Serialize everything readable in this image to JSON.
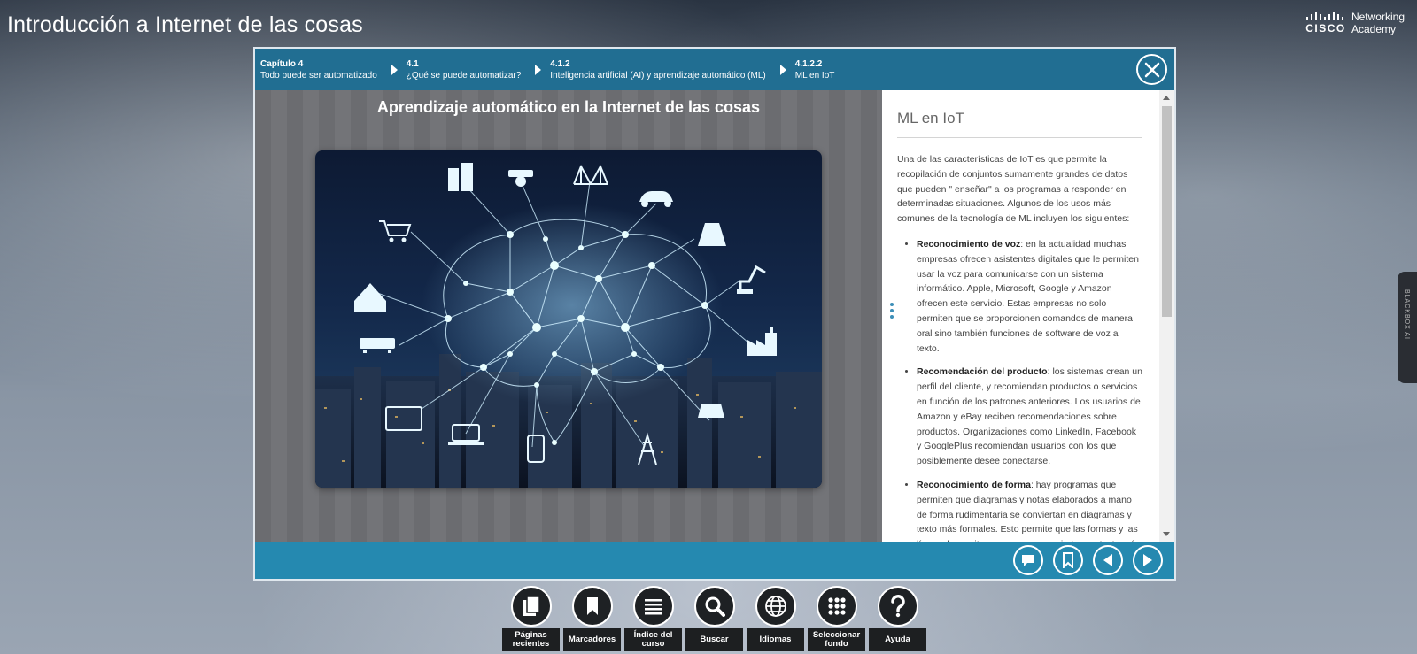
{
  "app": {
    "title": "Introducción a Internet de las cosas",
    "logo": {
      "brand": "CISCO",
      "line1": "Networking",
      "line2": "Academy"
    }
  },
  "breadcrumbs": [
    {
      "num": "Capítulo 4",
      "label": "Todo puede ser automatizado"
    },
    {
      "num": "4.1",
      "label": "¿Qué se puede automatizar?"
    },
    {
      "num": "4.1.2",
      "label": "Inteligencia artificial (AI) y aprendizaje automático (ML)"
    },
    {
      "num": "4.1.2.2",
      "label": "ML en IoT"
    }
  ],
  "close_icon": "close-icon",
  "slide": {
    "title": "Aprendizaje automático en la Internet de las cosas"
  },
  "article": {
    "heading": "ML en IoT",
    "intro": "Una de las características de IoT es que permite la recopilación de conjuntos sumamente grandes de datos que pueden \" enseñar\"  a los programas a responder en determinadas situaciones. Algunos de los usos más comunes de la tecnología de ML incluyen los siguientes:",
    "items": [
      {
        "term": "Reconocimiento de voz",
        "text": ": en la actualidad muchas empresas ofrecen asistentes digitales que le permiten usar la voz para comunicarse con un sistema informático. Apple, Microsoft, Google y Amazon ofrecen este servicio. Estas empresas no solo permiten que se proporcionen comandos de manera oral sino también funciones de software de voz a texto."
      },
      {
        "term": "Recomendación del producto",
        "text": ": los sistemas crean un perfil del cliente, y recomiendan productos o servicios en función de los patrones anteriores. Los usuarios de Amazon y eBay reciben recomendaciones sobre productos. Organizaciones como LinkedIn, Facebook y GooglePlus recomiendan usuarios con los que posiblemente desee conectarse."
      },
      {
        "term": "Reconocimiento de forma",
        "text": ": hay programas que permiten que diagramas y notas elaborados a mano de forma rudimentaria se conviertan en diagramas y texto más formales. Esto permite que las formas y las líneas de escritura a mano se conviertan en texto más formal, que posteriormente puede buscarse y analizarse."
      }
    ]
  },
  "footer_buttons": [
    {
      "icon": "comment-icon"
    },
    {
      "icon": "bookmark-icon"
    },
    {
      "icon": "previous-icon"
    },
    {
      "icon": "next-icon"
    }
  ],
  "toolbar": [
    {
      "icon": "pages-icon",
      "label": "Páginas recientes"
    },
    {
      "icon": "bookmark-icon",
      "label": "Marcadores"
    },
    {
      "icon": "list-icon",
      "label": "Índice del curso"
    },
    {
      "icon": "search-icon",
      "label": "Buscar"
    },
    {
      "icon": "globe-icon",
      "label": "Idiomas"
    },
    {
      "icon": "grid-icon",
      "label": "Seleccionar fondo"
    },
    {
      "icon": "help-icon",
      "label": "Ayuda"
    }
  ],
  "side_tab": {
    "label": "BLACKBOX AI"
  }
}
